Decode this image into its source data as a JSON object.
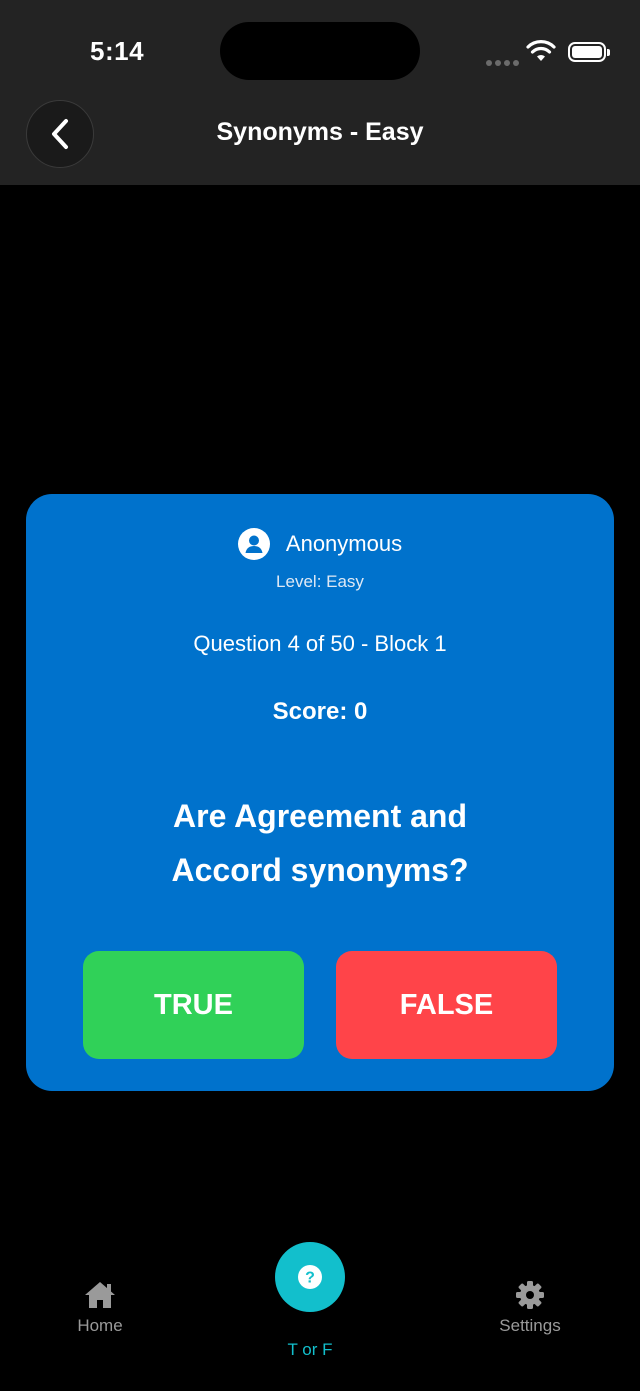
{
  "status_bar": {
    "time": "5:14"
  },
  "header": {
    "title": "Synonyms - Easy"
  },
  "quiz": {
    "user_name": "Anonymous",
    "level_text": "Level: Easy",
    "progress_text": "Question 4 of 50 - Block 1",
    "score_text": "Score: 0",
    "question_line1": "Are Agreement and",
    "question_line2": "Accord synonyms?",
    "true_label": "TRUE",
    "false_label": "FALSE"
  },
  "tabbar": {
    "items": [
      {
        "label": "Home",
        "icon": "home-icon"
      },
      {
        "label": "T or F",
        "icon": "question-icon",
        "active": true
      },
      {
        "label": "Settings",
        "icon": "gear-icon"
      }
    ]
  },
  "colors": {
    "header_bg": "#232323",
    "card_bg": "#0072cc",
    "true_button": "#30d158",
    "false_button": "#ff4449",
    "accent": "#12bfcc"
  }
}
